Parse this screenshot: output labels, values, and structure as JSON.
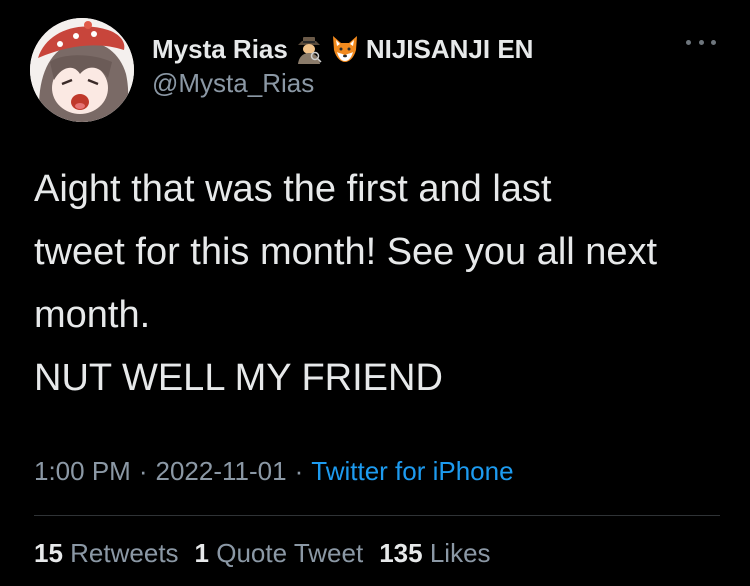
{
  "author": {
    "display_name": "Mysta Rias",
    "emojis": [
      "detective-emoji",
      "fox-emoji"
    ],
    "affiliation": "NIJISANJI EN",
    "handle": "@Mysta_Rias",
    "avatar": "avatar-image"
  },
  "tweet": {
    "lines": [
      "Aight that was the first and last",
      "tweet for this month! See you all next",
      "month.",
      "NUT WELL MY FRIEND"
    ]
  },
  "meta": {
    "time": "1:00 PM",
    "separator": "·",
    "date": "2022-11-01",
    "source": "Twitter for iPhone"
  },
  "stats": [
    {
      "count": "15",
      "label": "Retweets"
    },
    {
      "count": "1",
      "label": "Quote Tweet"
    },
    {
      "count": "135",
      "label": "Likes"
    }
  ],
  "colors": {
    "background": "#000000",
    "text": "#e7e9ea",
    "secondary": "#8b98a5",
    "link": "#1d9bf0",
    "divider": "#2f3336"
  }
}
